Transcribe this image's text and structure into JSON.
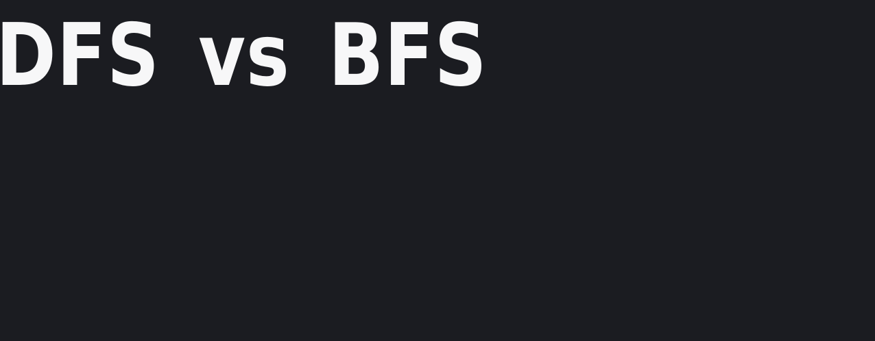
{
  "slide": {
    "title": "DFS vs BFS",
    "background_color": "#1b1c21",
    "text_color": "#f7f7f8"
  }
}
